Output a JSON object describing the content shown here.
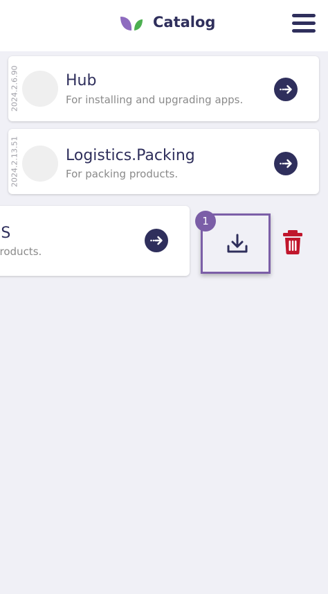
{
  "header": {
    "title": "Catalog",
    "logo_icon": "leaf-logo-icon",
    "menu_icon": "hamburger-menu-icon"
  },
  "apps": [
    {
      "version": "2024.2.6.90",
      "name": "Hub",
      "description": "For installing and upgrading apps.",
      "open_icon": "arrow-right-circle-icon"
    },
    {
      "version": "2024.2.13.51",
      "name": "Logistics.Packing",
      "description": "For packing products.",
      "open_icon": "arrow-right-circle-icon"
    }
  ],
  "swiped_app": {
    "name_fragment": "os",
    "description_fragment": "products.",
    "open_icon": "arrow-right-circle-icon"
  },
  "swipe_actions": {
    "download_icon": "download-icon",
    "delete_icon": "trash-icon",
    "step_badge": "1"
  },
  "colors": {
    "primary": "#2f2f5c",
    "background": "#f0f0f6",
    "highlight": "#7b5ea7",
    "delete": "#c0162c",
    "leaf_purple": "#8e6bbf",
    "leaf_green": "#4caf50"
  }
}
